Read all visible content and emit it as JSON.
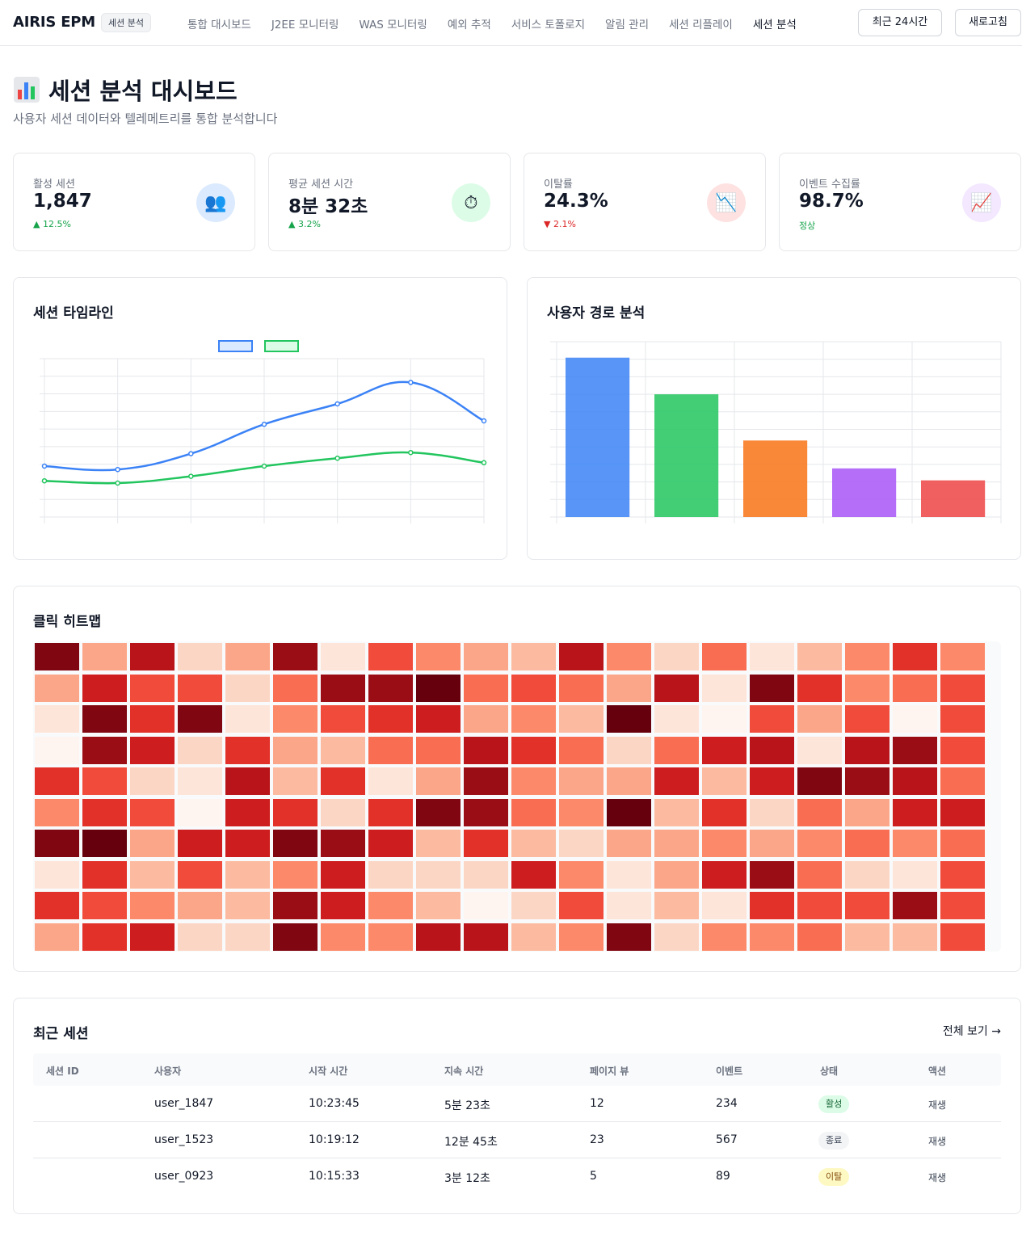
{
  "nav": {
    "brand": "AIRIS EPM",
    "badge": "세션 분석",
    "links": [
      "통합 대시보드",
      "J2EE 모니터링",
      "WAS 모니터링",
      "예외 추적",
      "서비스 토폴로지",
      "알림 관리",
      "세션 리플레이",
      "세션 분석"
    ],
    "time_range": "최근 24시간",
    "refresh": "새로고침"
  },
  "header": {
    "title": "세션 분석 대시보드",
    "subtitle": "사용자 세션 데이터와 텔레메트리를 통합 분석합니다"
  },
  "stats": [
    {
      "label": "활성 세션",
      "value": "1,847",
      "delta": "▲ 12.5%",
      "delta_color": "#16a34a",
      "icon": "users-icon",
      "glyph": "👥",
      "icon_bg": "#dbeafe"
    },
    {
      "label": "평균 세션 시간",
      "value": "8분 32초",
      "delta": "▲ 3.2%",
      "delta_color": "#16a34a",
      "icon": "stopwatch-icon",
      "glyph": "⏱",
      "icon_bg": "#dcfce7"
    },
    {
      "label": "이탈률",
      "value": "24.3%",
      "delta": "▼ 2.1%",
      "delta_color": "#dc2626",
      "icon": "chart-down-icon",
      "glyph": "📉",
      "icon_bg": "#fee2e2"
    },
    {
      "label": "이벤트 수집률",
      "value": "98.7%",
      "delta": "정상",
      "delta_color": "#16a34a",
      "icon": "chart-up-icon",
      "glyph": "📈",
      "icon_bg": "#f3e8ff"
    }
  ],
  "timeline": {
    "title": "세션 타임라인",
    "series_colors": [
      "#3b82f6",
      "#22c55e"
    ]
  },
  "path": {
    "title": "사용자 경로 분석"
  },
  "heatmap": {
    "title": "클릭 히트맵",
    "levels": [
      "#fff5f0",
      "#fee5d9",
      "#fcd6c5",
      "#fcbba1",
      "#fca689",
      "#fc8a6a",
      "#f96e53",
      "#f14c3b",
      "#e23129",
      "#ce1d1f",
      "#b81419",
      "#9b0d15",
      "#800711",
      "#67000d"
    ],
    "grid": [
      [
        12,
        4,
        10,
        2,
        4,
        11,
        1,
        7,
        5,
        4,
        3,
        10,
        5,
        2,
        6,
        1,
        3,
        5,
        8,
        5
      ],
      [
        4,
        9,
        7,
        7,
        2,
        6,
        11,
        11,
        13,
        6,
        7,
        6,
        4,
        10,
        1,
        12,
        8,
        5,
        6,
        7
      ],
      [
        1,
        12,
        8,
        12,
        1,
        5,
        7,
        8,
        9,
        4,
        5,
        3,
        13,
        1,
        0,
        7,
        4,
        7,
        0,
        7
      ],
      [
        0,
        11,
        9,
        2,
        8,
        4,
        3,
        6,
        6,
        10,
        8,
        6,
        2,
        6,
        9,
        10,
        1,
        10,
        11,
        7
      ],
      [
        8,
        7,
        2,
        1,
        10,
        3,
        8,
        1,
        4,
        11,
        5,
        4,
        4,
        9,
        3,
        9,
        12,
        11,
        10,
        6
      ],
      [
        5,
        8,
        7,
        0,
        9,
        8,
        2,
        8,
        12,
        11,
        6,
        5,
        13,
        3,
        8,
        2,
        6,
        4,
        9,
        9
      ],
      [
        12,
        13,
        4,
        9,
        9,
        12,
        11,
        9,
        3,
        8,
        3,
        2,
        4,
        4,
        5,
        4,
        5,
        6,
        5,
        6
      ],
      [
        1,
        8,
        3,
        7,
        3,
        5,
        9,
        2,
        2,
        2,
        9,
        5,
        1,
        4,
        9,
        11,
        6,
        2,
        1,
        7
      ],
      [
        8,
        7,
        5,
        4,
        3,
        11,
        9,
        5,
        3,
        0,
        2,
        7,
        1,
        3,
        1,
        8,
        7,
        7,
        11,
        7
      ],
      [
        4,
        8,
        9,
        2,
        2,
        12,
        5,
        5,
        10,
        10,
        3,
        5,
        12,
        2,
        5,
        5,
        6,
        3,
        3,
        7
      ]
    ]
  },
  "sessions": {
    "title": "최근 세션",
    "view_all": "전체 보기 →",
    "columns": [
      "세션 ID",
      "사용자",
      "시작 시간",
      "지속 시간",
      "페이지 뷰",
      "이벤트",
      "상태",
      "액션"
    ],
    "rows": [
      {
        "id": "",
        "user": "user_1847",
        "start": "10:23:45",
        "duration": "5분 23초",
        "views": "12",
        "events": "234",
        "status": "활성",
        "status_bg": "#dcfce7",
        "status_fg": "#166534",
        "action": "재생"
      },
      {
        "id": "",
        "user": "user_1523",
        "start": "10:19:12",
        "duration": "12분 45초",
        "views": "23",
        "events": "567",
        "status": "종료",
        "status_bg": "#f3f4f6",
        "status_fg": "#374151",
        "action": "재생"
      },
      {
        "id": "",
        "user": "user_0923",
        "start": "10:15:33",
        "duration": "3분 12초",
        "views": "5",
        "events": "89",
        "status": "이탈",
        "status_bg": "#fef9c3",
        "status_fg": "#854d0e",
        "action": "재생"
      }
    ]
  },
  "chart_data": [
    {
      "type": "line",
      "title": "세션 타임라인",
      "x": [
        0,
        1,
        2,
        3,
        4,
        5,
        6
      ],
      "series": [
        {
          "values": [
            45,
            42,
            56,
            82,
            100,
            119,
            85
          ]
        },
        {
          "values": [
            32,
            30,
            36,
            45,
            52,
            57,
            48
          ]
        }
      ],
      "ylim": [
        0,
        140
      ],
      "grid": true,
      "legend_position": "top-center"
    },
    {
      "type": "bar",
      "title": "사용자 경로 분석",
      "categories": [
        "",
        "",
        "",
        "",
        ""
      ],
      "values": [
        1000,
        770,
        480,
        305,
        230
      ],
      "ylim": [
        0,
        1100
      ],
      "grid": true
    }
  ]
}
